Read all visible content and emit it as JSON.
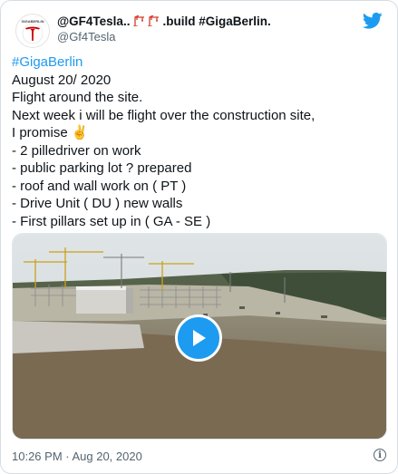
{
  "tweet": {
    "display_name_prefix": "@GF4Tesla..",
    "display_name_suffix": ".build #GigaBerlin.",
    "handle": "@Gf4Tesla",
    "avatar_wordmark": "GIGABERLIN",
    "lines": [
      "#GigaBerlin",
      "August 20/ 2020",
      "Flight around the site.",
      "Next week i will be flight over the construction site,",
      "I promise ✌️",
      "- 2 pilledriver on work",
      "- public parking lot ? prepared",
      "- roof and wall work on ( PT )",
      "- Drive Unit ( DU ) new walls",
      "- First pillars set up in ( GA - SE )"
    ],
    "timestamp": "10:26 PM · Aug 20, 2020"
  },
  "icons": {
    "crane": "construction-crane-icon",
    "twitter": "twitter-bird-icon",
    "play": "play-icon",
    "info": "info-icon"
  },
  "colors": {
    "accent": "#1d9bf0",
    "text": "#0f1419",
    "muted": "#536471",
    "crane": "#d43a2f"
  }
}
